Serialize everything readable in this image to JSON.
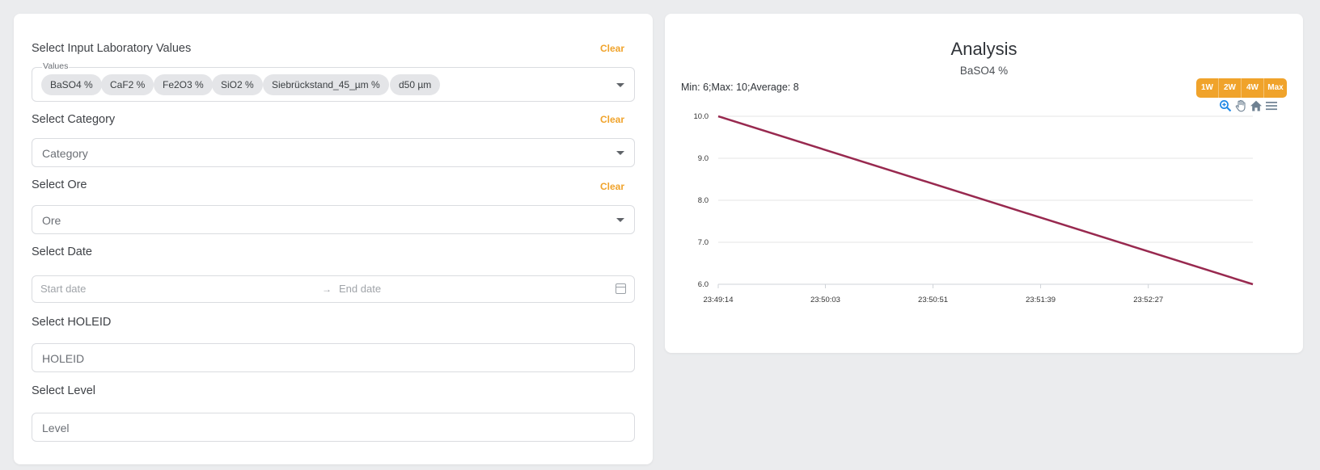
{
  "filters": {
    "lab_values": {
      "title": "Select Input Laboratory Values",
      "clear": "Clear",
      "legend": "Values",
      "chips": [
        "BaSO4 %",
        "CaF2 %",
        "Fe2O3 %",
        "SiO2 %",
        "Siebrückstand_45_µm %",
        "d50 µm"
      ]
    },
    "category": {
      "title": "Select Category",
      "clear": "Clear",
      "placeholder": "Category"
    },
    "ore": {
      "title": "Select Ore",
      "clear": "Clear",
      "placeholder": "Ore"
    },
    "date": {
      "title": "Select Date",
      "start_placeholder": "Start date",
      "end_placeholder": "End date",
      "separator": "→"
    },
    "holeid": {
      "title": "Select HOLEID",
      "placeholder": "HOLEID"
    },
    "level": {
      "title": "Select Level",
      "placeholder": "Level"
    }
  },
  "analysis": {
    "stats": "Min: 6;Max: 10;Average: 8",
    "range_buttons": [
      "1W",
      "2W",
      "4W",
      "Max"
    ],
    "toolbar_icons": [
      "zoom-in-icon",
      "pan-hand-icon",
      "home-icon",
      "menu-icon"
    ]
  },
  "colors": {
    "accent": "#f0a32b",
    "line": "#98294f",
    "chip": "#e4e5e8"
  },
  "chart_data": {
    "type": "line",
    "title": "Analysis",
    "subtitle": "BaSO4 %",
    "x": [
      "23:49:14",
      "23:53:14"
    ],
    "x_ticks": [
      "23:49:14",
      "23:50:03",
      "23:50:51",
      "23:51:39",
      "23:52:27"
    ],
    "y_ticks": [
      "6.0",
      "7.0",
      "8.0",
      "9.0",
      "10.0"
    ],
    "ylim": [
      6,
      10
    ],
    "series": [
      {
        "values": [
          10,
          6
        ]
      }
    ],
    "grid": true
  }
}
